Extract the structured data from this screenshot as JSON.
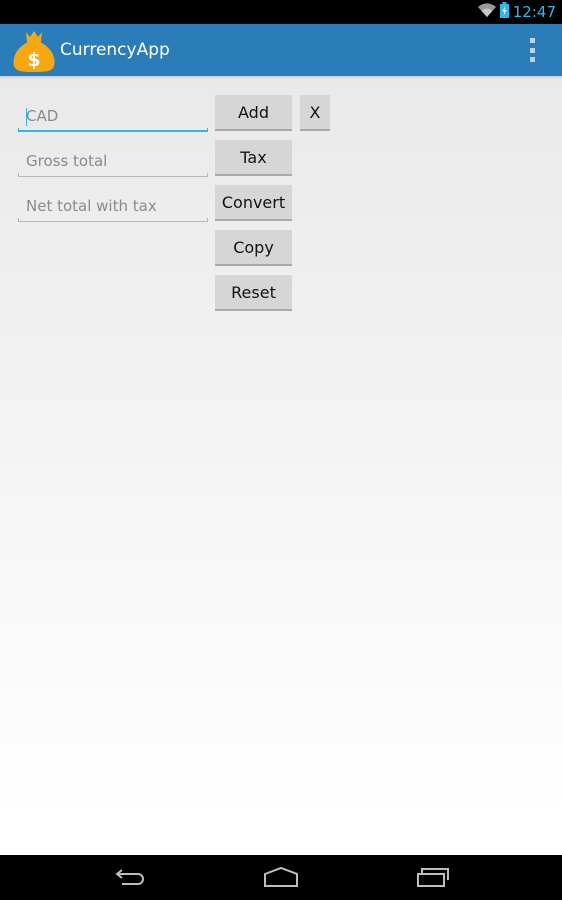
{
  "status_bar": {
    "time": "12:47",
    "icons": [
      "wifi-icon",
      "battery-charging-icon"
    ],
    "accent_color": "#33b5e5"
  },
  "action_bar": {
    "title": "CurrencyApp",
    "app_icon": "money-bag-icon",
    "overflow_icon": "overflow-menu-icon",
    "background_color": "#2a7db8"
  },
  "form": {
    "currency_field": {
      "placeholder": "CAD",
      "value": ""
    },
    "gross_total_field": {
      "placeholder": "Gross total",
      "value": ""
    },
    "net_total_field": {
      "placeholder": "Net total with tax",
      "value": ""
    }
  },
  "buttons": {
    "add": "Add",
    "clear": "X",
    "tax": "Tax",
    "convert": "Convert",
    "copy": "Copy",
    "reset": "Reset"
  },
  "nav_bar": {
    "icons": [
      "back-icon",
      "home-icon",
      "recent-apps-icon"
    ]
  }
}
